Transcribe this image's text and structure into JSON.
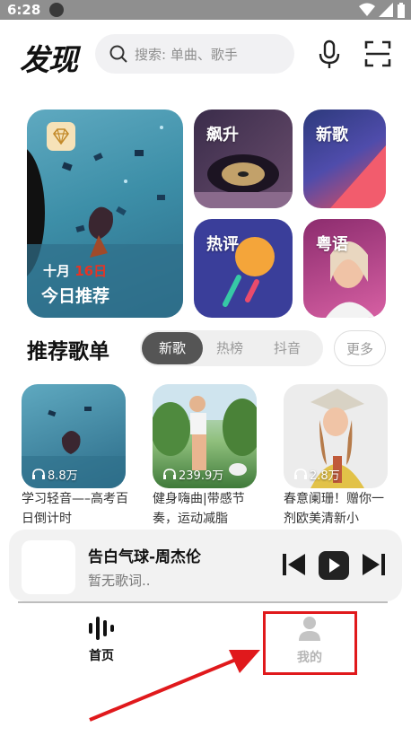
{
  "status_bar": {
    "time": "6:28"
  },
  "header": {
    "logo": "发现",
    "search_placeholder": "搜索: 单曲、歌手",
    "icons": [
      "search-icon",
      "microphone-icon",
      "scan-icon"
    ]
  },
  "cards": {
    "daily": {
      "month": "十月",
      "day": "16日",
      "title": "今日推荐"
    },
    "soaring": "飙升",
    "new_songs": "新歌",
    "hot_comments": "热评",
    "cantonese": "粤语"
  },
  "playlist_section": {
    "title": "推荐歌单",
    "tabs": [
      {
        "label": "新歌",
        "active": true
      },
      {
        "label": "热榜",
        "active": false
      },
      {
        "label": "抖音",
        "active": false
      }
    ],
    "more": "更多",
    "items": [
      {
        "count": "8.8万",
        "title": "学习轻音—–高考百日倒计时"
      },
      {
        "count": "239.9万",
        "title": "健身嗨曲|带感节奏，运动减脂"
      },
      {
        "count": "2.8万",
        "title": "春意阑珊！赠你一剂欧美清新小"
      }
    ]
  },
  "player": {
    "title": "告白气球-周杰伦",
    "subtitle": "暂无歌词.."
  },
  "bottom_nav": {
    "home": "首页",
    "mine": "我的"
  },
  "colors": {
    "accent_red": "#e0191c",
    "tab_active": "#555555",
    "date_red": "#e83323"
  }
}
